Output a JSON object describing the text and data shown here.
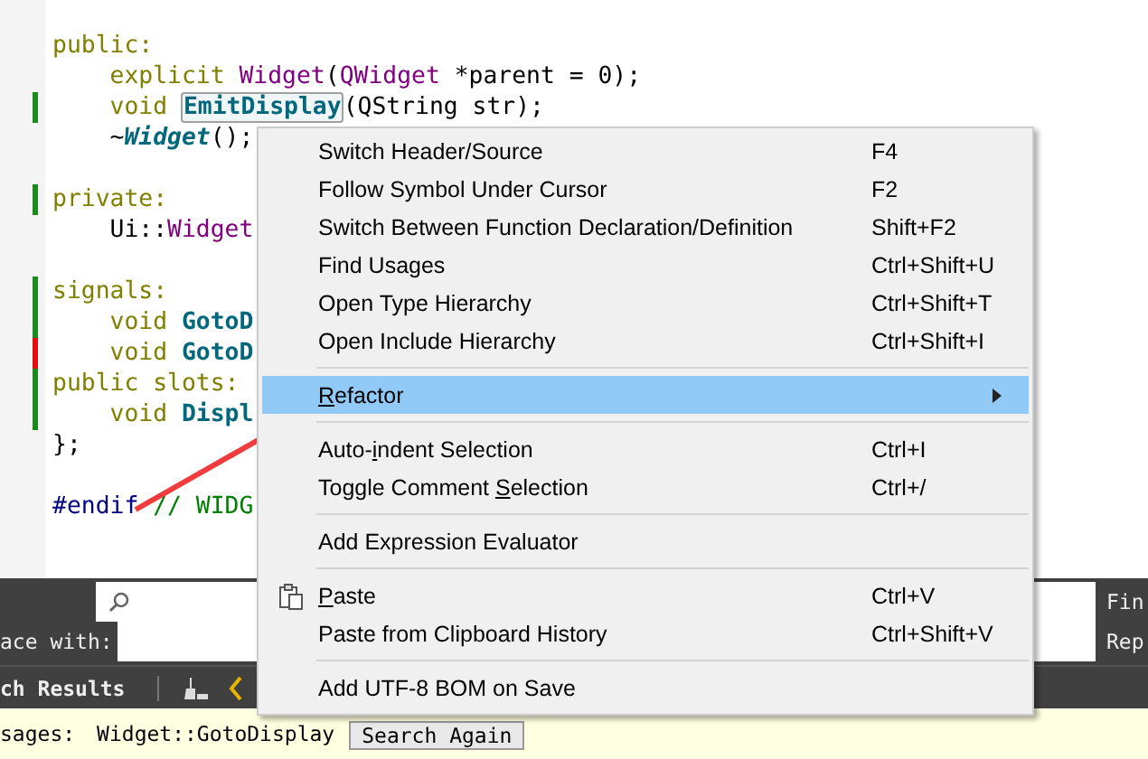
{
  "editor": {
    "blocks": [
      {
        "lines": [
          {
            "tokens": [
              {
                "kind": "keyword",
                "text": "public:"
              }
            ]
          },
          {
            "tokens": [
              {
                "kind": "keyword",
                "text": "    explicit "
              },
              {
                "kind": "type",
                "text": "Widget"
              },
              {
                "kind": "plain",
                "text": "("
              },
              {
                "kind": "type",
                "text": "QWidget"
              },
              {
                "kind": "plain",
                "text": " *parent = 0);"
              }
            ]
          },
          {
            "color": "#1d8a1d",
            "tokens": [
              {
                "kind": "keyword",
                "text": "    void "
              },
              {
                "kind": "func",
                "text": "EmitDisplay",
                "boxed": true
              },
              {
                "kind": "plain",
                "text": "(QString str);"
              }
            ]
          },
          {
            "tokens": [
              {
                "kind": "plain",
                "text": "    ~"
              },
              {
                "kind": "italic",
                "text": "Widget"
              },
              {
                "kind": "plain",
                "text": "();"
              }
            ]
          }
        ]
      },
      {
        "lines": [
          {
            "color": "#1d8a1d",
            "tokens": [
              {
                "kind": "keyword",
                "text": "private:"
              }
            ]
          },
          {
            "tokens": [
              {
                "kind": "plain",
                "text": "    Ui::"
              },
              {
                "kind": "type",
                "text": "Widget"
              }
            ]
          }
        ]
      },
      {
        "lines": [
          {
            "color": "#1d8a1d",
            "tokens": [
              {
                "kind": "keyword",
                "text": "signals:"
              }
            ]
          },
          {
            "color": "#1d8a1d",
            "tokens": [
              {
                "kind": "keyword",
                "text": "    void "
              },
              {
                "kind": "func",
                "text": "GotoD"
              }
            ]
          },
          {
            "color": "#e01010",
            "tokens": [
              {
                "kind": "keyword",
                "text": "    void "
              },
              {
                "kind": "func",
                "text": "GotoD"
              }
            ]
          },
          {
            "color": "#1d8a1d",
            "tokens": [
              {
                "kind": "keyword",
                "text": "public slots:"
              }
            ]
          },
          {
            "color": "#1d8a1d",
            "tokens": [
              {
                "kind": "keyword",
                "text": "    void "
              },
              {
                "kind": "func",
                "text": "Displ"
              }
            ]
          },
          {
            "tokens": [
              {
                "kind": "plain",
                "text": "};"
              }
            ]
          }
        ]
      },
      {
        "lines": [
          {
            "tokens": [
              {
                "kind": "preproc",
                "text": "#endif"
              },
              {
                "kind": "comment",
                "text": " // WIDG"
              }
            ]
          }
        ]
      }
    ]
  },
  "find_panel": {
    "find_label": "Fin",
    "replace_prefix": "ace with:",
    "replace_label": "Rep"
  },
  "results_bar": {
    "tab": "ch Results"
  },
  "results": {
    "label": "sages:",
    "term": "Widget::GotoDisplay",
    "button": "Search Again"
  },
  "context_menu": {
    "items": [
      {
        "kind": "item",
        "before": "Switch Header/Source",
        "shortcut": "F4",
        "selected": false
      },
      {
        "kind": "item",
        "before": "Follow Symbol Under Cursor",
        "shortcut": "F2",
        "selected": false
      },
      {
        "kind": "item",
        "before": "Switch Between Function Declaration/Definition",
        "shortcut": "Shift+F2",
        "selected": false
      },
      {
        "kind": "item",
        "before": "Find Usages",
        "shortcut": "Ctrl+Shift+U",
        "selected": false
      },
      {
        "kind": "item",
        "before": "Open Type Hierarchy",
        "shortcut": "Ctrl+Shift+T",
        "selected": false
      },
      {
        "kind": "item",
        "before": "Open Include Hierarchy",
        "shortcut": "Ctrl+Shift+I",
        "selected": false
      },
      {
        "kind": "separator"
      },
      {
        "kind": "submenu",
        "key": "R",
        "after": "efactor",
        "selected": true
      },
      {
        "kind": "separator"
      },
      {
        "kind": "item",
        "before": "Auto-",
        "key": "i",
        "after": "ndent Selection",
        "shortcut": "Ctrl+I",
        "selected": false
      },
      {
        "kind": "item",
        "before": "Toggle Comment ",
        "key": "S",
        "after": "election",
        "shortcut": "Ctrl+/",
        "selected": false
      },
      {
        "kind": "separator"
      },
      {
        "kind": "item",
        "before": "Add Expression Evaluator",
        "selected": false
      },
      {
        "kind": "separator"
      },
      {
        "kind": "paste",
        "key": "P",
        "after": "aste",
        "shortcut": "Ctrl+V",
        "selected": false
      },
      {
        "kind": "item",
        "before": "Paste from Clipboard History",
        "shortcut": "Ctrl+Shift+V",
        "selected": false
      },
      {
        "kind": "separator"
      },
      {
        "kind": "item",
        "before": "Add UTF-8 BOM on Save",
        "selected": false
      }
    ]
  }
}
